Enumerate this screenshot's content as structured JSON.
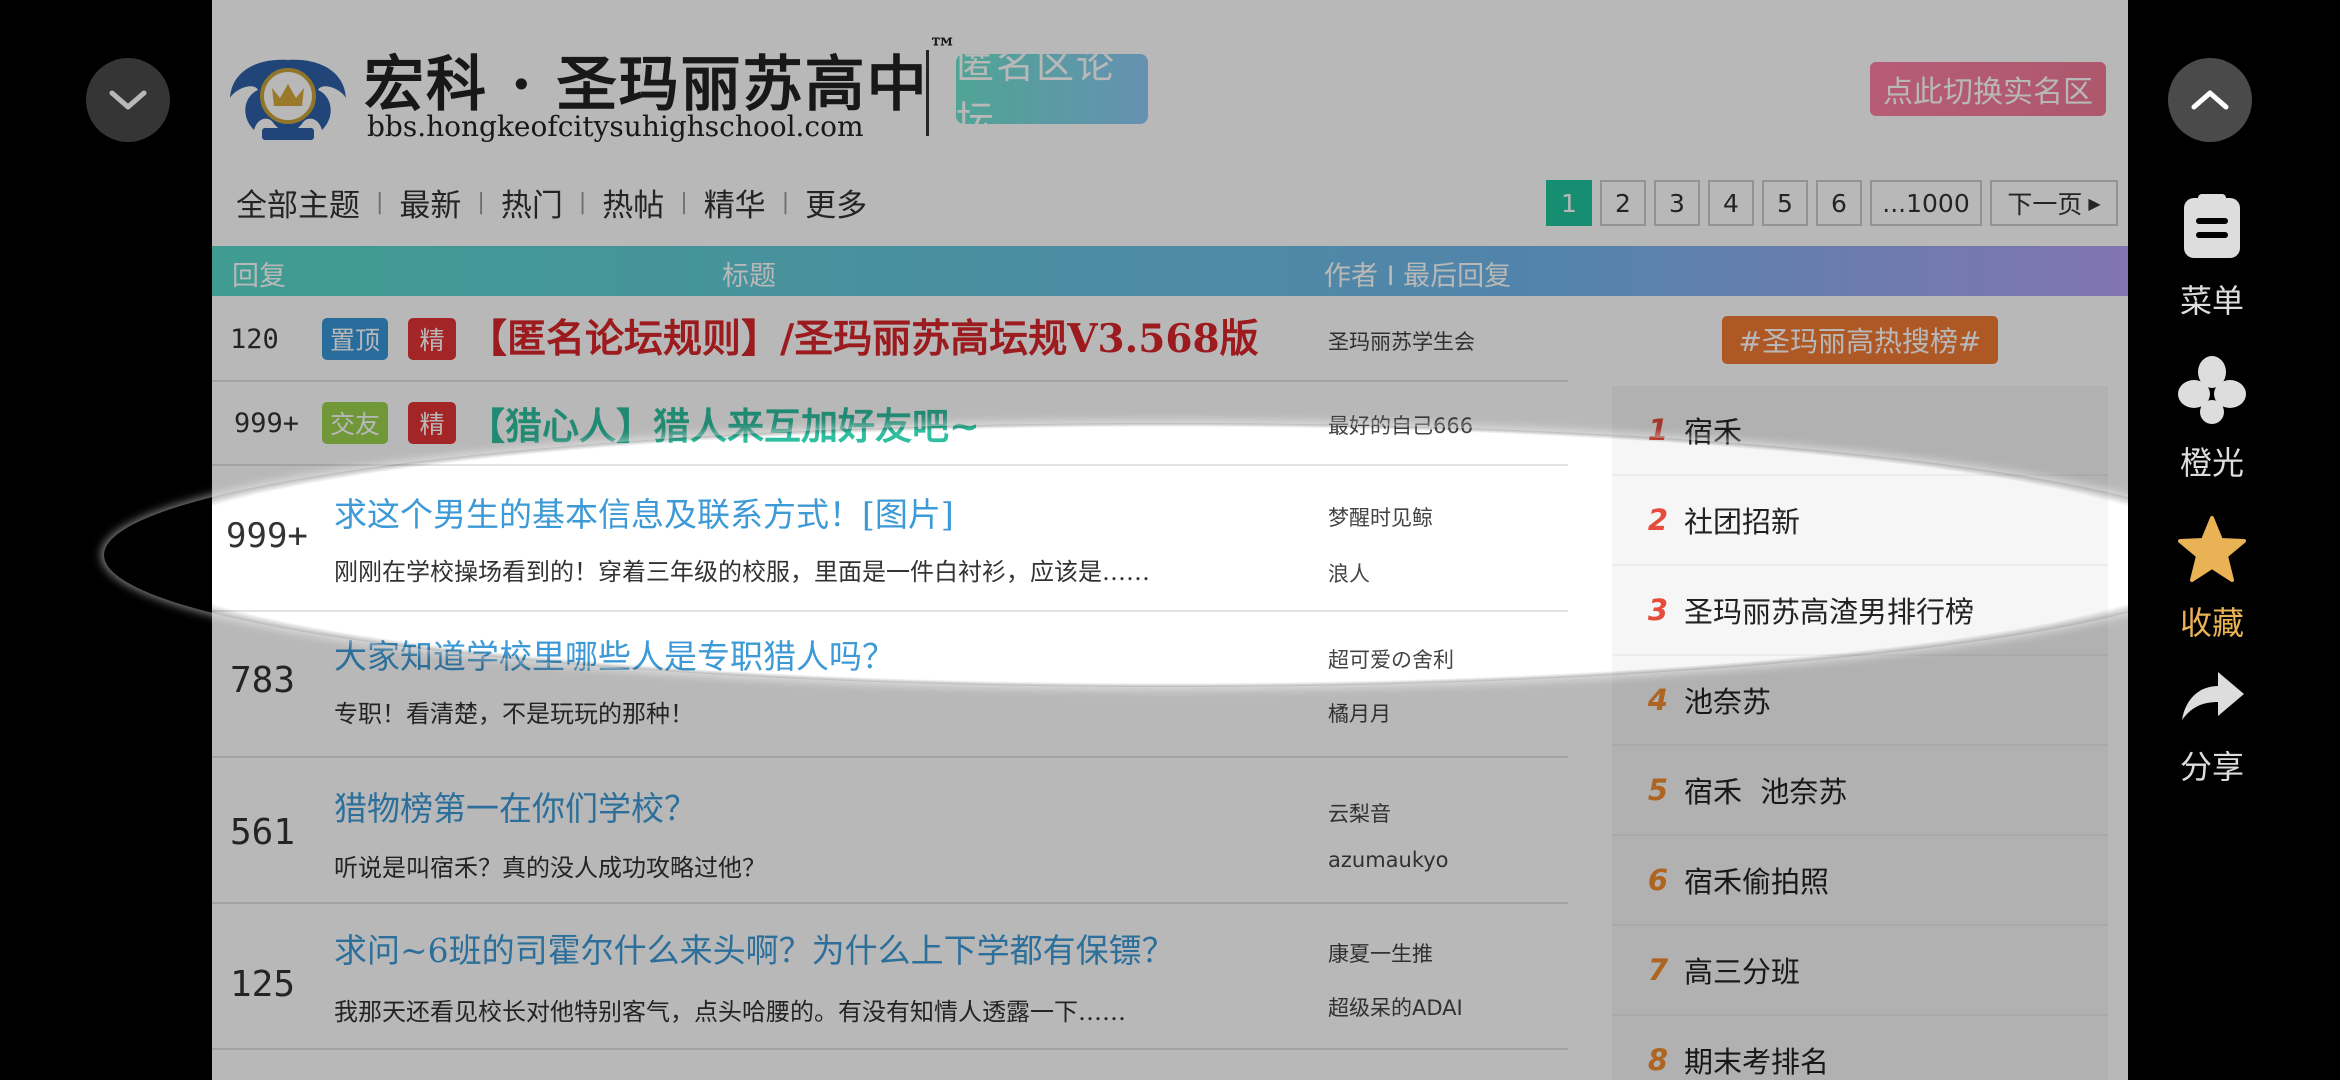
{
  "header": {
    "site_title": "宏科 · 圣玛丽苏高中",
    "tm": "™",
    "site_url": "bbs.hongkeofcitysuhighschool.com",
    "anon_badge": "匿名区论坛",
    "switch_button": "点此切换实名区"
  },
  "nav": {
    "items": [
      "全部主题",
      "最新",
      "热门",
      "热帖",
      "精华",
      "更多"
    ]
  },
  "pagination": {
    "pages": [
      "1",
      "2",
      "3",
      "4",
      "5",
      "6",
      "...1000"
    ],
    "next": "下一页",
    "active": "1"
  },
  "table_header": {
    "replies": "回复",
    "title": "标题",
    "author": "作者 I 最后回复"
  },
  "threads": [
    {
      "count": "120",
      "tags": [
        "置顶",
        "精"
      ],
      "title": "【匿名论坛规则】/圣玛丽苏高坛规V3.568版",
      "author": "圣玛丽苏学生会"
    },
    {
      "count": "999+",
      "tags": [
        "交友",
        "精"
      ],
      "title": "【猎心人】猎人来互加好友吧~",
      "author": "最好的自己666"
    },
    {
      "count": "999+",
      "title": "求这个男生的基本信息及联系方式！[图片]",
      "excerpt": "刚刚在学校操场看到的！穿着三年级的校服，里面是一件白衬衫，应该是……",
      "author": "梦醒时见鲸",
      "last_reply": "浪人"
    },
    {
      "count": "783",
      "title": "大家知道学校里哪些人是专职猎人吗？",
      "excerpt": "专职！看清楚，不是玩玩的那种！",
      "author": "超可爱の舍利",
      "last_reply": "橘月月"
    },
    {
      "count": "561",
      "title": "猎物榜第一在你们学校？",
      "excerpt": "听说是叫宿禾？真的没人成功攻略过他？",
      "author": "云梨音",
      "last_reply": "azumaukyo"
    },
    {
      "count": "125",
      "title": "求问~6班的司霍尔什么来头啊？为什么上下学都有保镖？",
      "excerpt": "我那天还看见校长对他特别客气，点头哈腰的。有没有知情人透露一下……",
      "author": "康夏一生推",
      "last_reply": "超级呆的ADAI"
    }
  ],
  "hot_search": {
    "title": "#圣玛丽高热搜榜#",
    "items": [
      {
        "rank": "1",
        "text": "宿禾"
      },
      {
        "rank": "2",
        "text": "社团招新"
      },
      {
        "rank": "3",
        "text": "圣玛丽苏高渣男排行榜"
      },
      {
        "rank": "4",
        "text": "池奈苏"
      },
      {
        "rank": "5",
        "text": "宿禾  池奈苏"
      },
      {
        "rank": "6",
        "text": "宿禾偷拍照"
      },
      {
        "rank": "7",
        "text": "高三分班"
      },
      {
        "rank": "8",
        "text": "期末考排名"
      }
    ]
  },
  "side_menu": {
    "menu": "菜单",
    "orange": "橙光",
    "favorite": "收藏",
    "share": "分享"
  },
  "colors": {
    "accent_teal": "#20c59f",
    "pin_tag": "#3a98d8",
    "jing_tag": "#e23435",
    "friend_tag": "#9bd14e",
    "thread_title": "#3d9ad6",
    "hot_tag": "#f27a34",
    "rank_top": "#e54c3c",
    "rank_other": "#f08c2e",
    "favorite": "#e9b254"
  }
}
